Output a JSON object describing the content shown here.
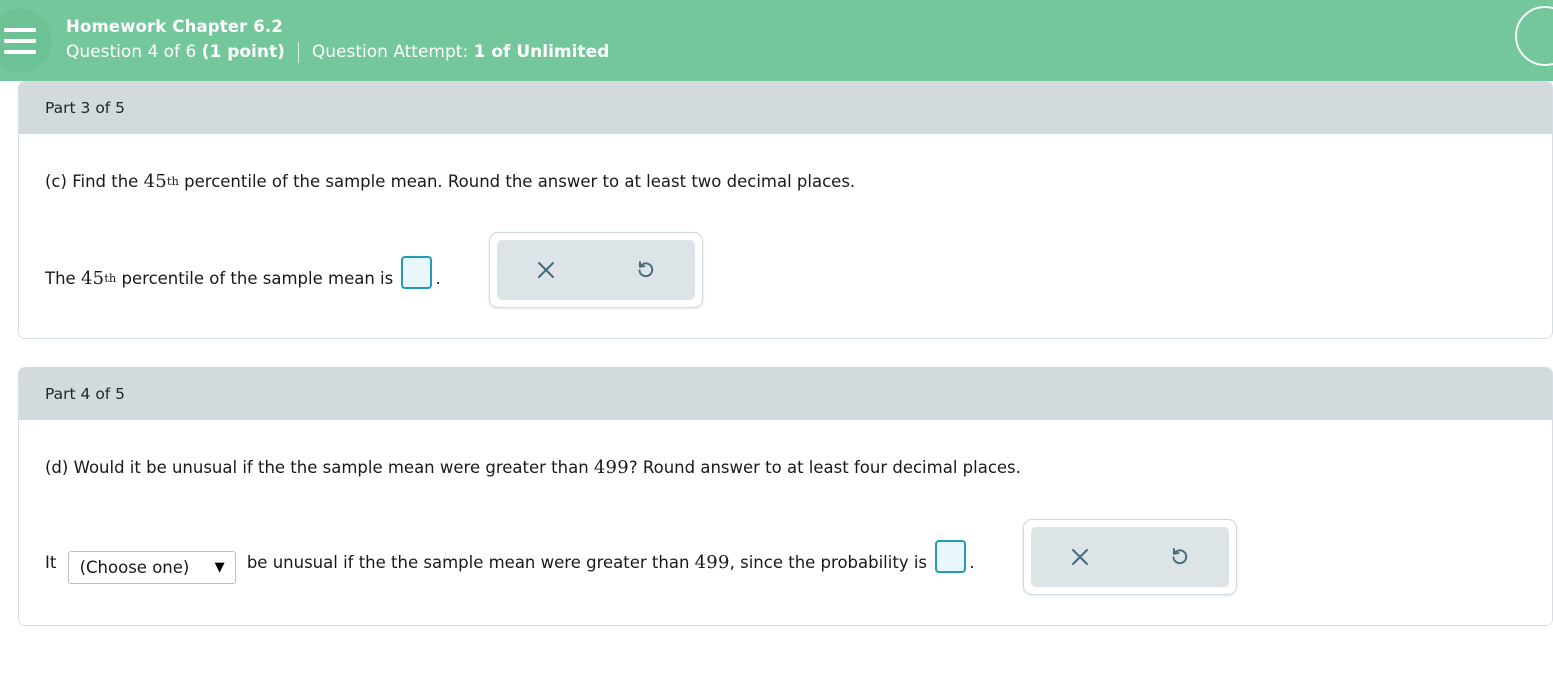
{
  "header": {
    "menu_icon": "hamburger-menu-icon",
    "title": "Homework Chapter 6.2",
    "question_label": "Question 4 of 6 ",
    "points": "(1 point)",
    "attempt_label": "Question Attempt: ",
    "attempt_value": "1 of Unlimited",
    "accent_color": "#73c79b",
    "right_icon": "profile-circle-icon"
  },
  "parts": [
    {
      "part_label": "Part 3 of 5",
      "question": {
        "prefix": "(c) Find the ",
        "number": "45",
        "ordinal": "th",
        "suffix": " percentile of the sample mean. Round the answer to at least two decimal places."
      },
      "answer": {
        "prefix": "The ",
        "number": "45",
        "ordinal": "th",
        "middle": " percentile of the sample mean is ",
        "input_value": "",
        "input_placeholder": "",
        "suffix": "."
      },
      "tools": {
        "clear_icon": "close-x-icon",
        "undo_icon": "undo-arrow-icon"
      }
    },
    {
      "part_label": "Part 4 of 5",
      "question": {
        "prefix": "(d) Would it be unusual if the the sample mean were greater than ",
        "number": "499",
        "suffix": "? Round answer to at least four decimal places."
      },
      "answer": {
        "prefix": "It ",
        "select_value": "(Choose one)",
        "select_caret": "▼",
        "middle": " be unusual if the the sample mean were greater than ",
        "number": "499",
        "middle2": ", since the probability is ",
        "input_value": "",
        "input_placeholder": "",
        "suffix": "."
      },
      "tools": {
        "clear_icon": "close-x-icon",
        "undo_icon": "undo-arrow-icon"
      }
    }
  ],
  "colors": {
    "header_green": "#73c79b",
    "part_header_gray": "#d2dadd",
    "input_border_teal": "#1f9cbb",
    "tool_icon": "#456a7c"
  }
}
